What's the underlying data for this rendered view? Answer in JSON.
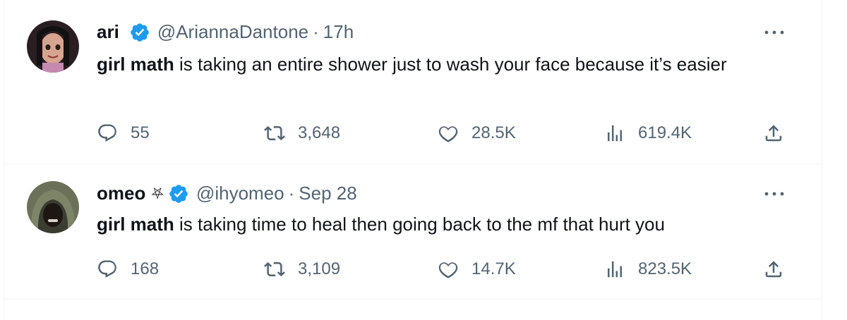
{
  "tweets": [
    {
      "name": "ari",
      "symbol": "",
      "handle": "@AriannaDantone",
      "separator": "·",
      "time": "17h",
      "text_bold": "girl math",
      "text_rest": " is taking an entire shower just to wash your face because it’s easier",
      "replies": "55",
      "retweets": "3,648",
      "likes": "28.5K",
      "views": "619.4K"
    },
    {
      "name": "omeo",
      "symbol": "⛧",
      "handle": "@ihyomeo",
      "separator": "·",
      "time": "Sep 28",
      "text_bold": "girl math",
      "text_rest": " is taking time to heal then going back to the mf that hurt you",
      "replies": "168",
      "retweets": "3,109",
      "likes": "14.7K",
      "views": "823.5K"
    }
  ],
  "colors": {
    "verified": "#1d9bf0",
    "secondary_text": "#536471",
    "primary_text": "#0f1419",
    "divider": "#eff3f4"
  },
  "icons": [
    "verified-badge-icon",
    "more-icon",
    "reply-icon",
    "retweet-icon",
    "like-icon",
    "views-icon",
    "share-icon"
  ]
}
